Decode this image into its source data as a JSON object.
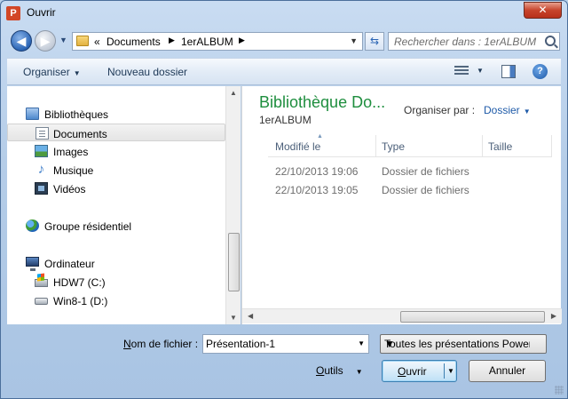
{
  "window": {
    "title": "Ouvrir",
    "app_icon_letter": "P",
    "close_glyph": "✕"
  },
  "nav": {
    "back_glyph": "◀",
    "forward_glyph": "▶",
    "breadcrumb_prefix": "«",
    "breadcrumb": [
      "Documents",
      "1erALBUM"
    ],
    "search_placeholder": "Rechercher dans : 1erALBUM"
  },
  "toolbar": {
    "organize": "Organiser",
    "new_folder": "Nouveau dossier",
    "help": "?"
  },
  "sidebar": {
    "libraries": "Bibliothèques",
    "library_items": [
      "Documents",
      "Images",
      "Musique",
      "Vidéos"
    ],
    "homegroup": "Groupe résidentiel",
    "computer": "Ordinateur",
    "drives": [
      "HDW7 (C:)",
      "Win8-1 (D:)"
    ],
    "selected": "Documents"
  },
  "filepane": {
    "library_title": "Bibliothèque Do...",
    "library_subtitle": "1erALBUM",
    "arrange_label": "Organiser par :",
    "arrange_value": "Dossier",
    "columns": [
      "Modifié le",
      "Type",
      "Taille"
    ],
    "rows": [
      {
        "modified": "22/10/2013 19:06",
        "type": "Dossier de fichiers"
      },
      {
        "modified": "22/10/2013 19:05",
        "type": "Dossier de fichiers"
      }
    ]
  },
  "footer": {
    "filename_label_accel": "N",
    "filename_label_rest": "om de fichier :",
    "filename_value": "Présentation-1",
    "filter": "Toutes les présentations Power",
    "tools_accel": "O",
    "tools_rest": "utils",
    "open_accel": "O",
    "open_rest": "uvrir",
    "cancel": "Annuler"
  },
  "colors": {
    "library_title": "#1e8e3e",
    "accent": "#1e5aa8",
    "close": "#c7442c"
  },
  "icons": {
    "sidebar": [
      "library-icon",
      "document-icon",
      "image-icon",
      "music-icon",
      "video-icon",
      "homegroup-icon",
      "computer-icon",
      "windows-drive-icon",
      "drive-icon"
    ]
  }
}
